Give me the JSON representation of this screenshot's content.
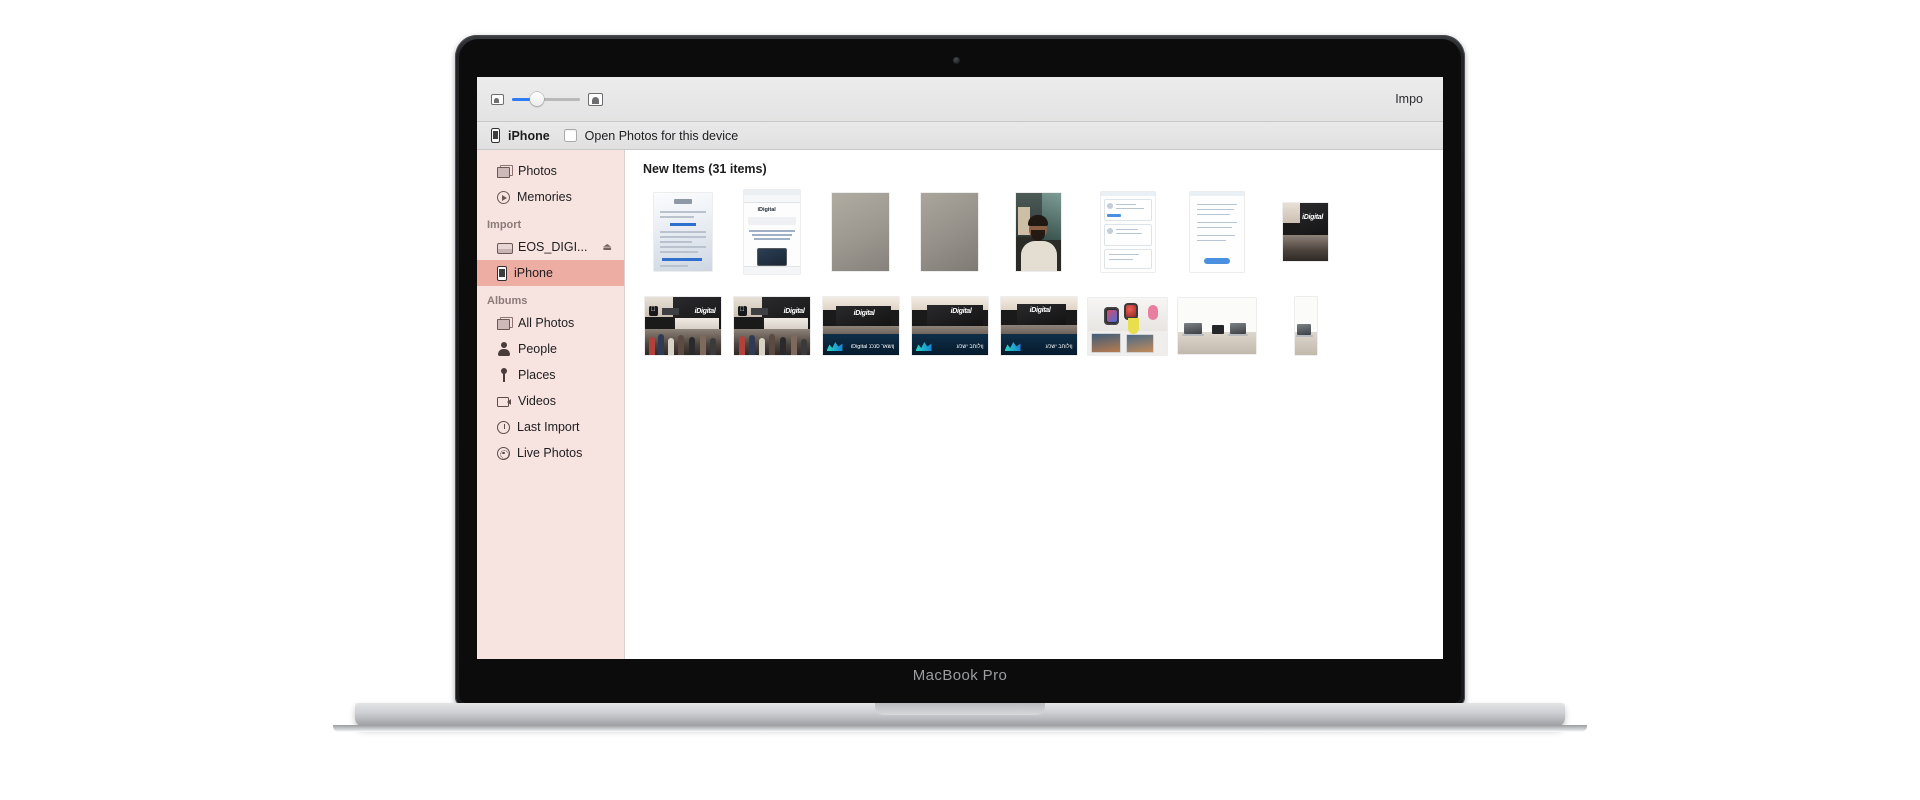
{
  "device": {
    "model_label": "MacBook Pro"
  },
  "app": {
    "toolbar": {
      "zoom_small_icon": "small-photo-icon",
      "zoom_large_icon": "large-photo-icon",
      "zoom_value_percent": 35,
      "import_button_label": "Impo"
    },
    "device_bar": {
      "device_icon": "iphone-icon",
      "device_name": "iPhone",
      "checkbox_checked": false,
      "checkbox_label": "Open Photos for this device"
    },
    "sidebar": {
      "selected": "iPhone",
      "groups": [
        {
          "header": "",
          "items": [
            {
              "label": "Photos",
              "icon": "photos-icon",
              "eject": ""
            },
            {
              "label": "Memories",
              "icon": "memories-icon",
              "eject": ""
            }
          ]
        },
        {
          "header": "Import",
          "items": [
            {
              "label": "EOS_DIGI...",
              "icon": "drive-icon",
              "eject": "⏏"
            },
            {
              "label": "iPhone",
              "icon": "iphone-icon",
              "eject": ""
            }
          ]
        },
        {
          "header": "Albums",
          "items": [
            {
              "label": "All Photos",
              "icon": "photos-icon",
              "eject": ""
            },
            {
              "label": "People",
              "icon": "people-icon",
              "eject": ""
            },
            {
              "label": "Places",
              "icon": "places-icon",
              "eject": ""
            },
            {
              "label": "Videos",
              "icon": "video-icon",
              "eject": ""
            },
            {
              "label": "Last Import",
              "icon": "clock-icon",
              "eject": ""
            },
            {
              "label": "Live Photos",
              "icon": "livephoto-icon",
              "eject": ""
            }
          ]
        }
      ]
    },
    "content": {
      "section_title": "New Items (31 items)",
      "item_count": 31,
      "thumbnails_row1": [
        {
          "kind": "document-scan",
          "caption": "scanned form document"
        },
        {
          "kind": "app-screenshot",
          "caption": "iDigital app order screen"
        },
        {
          "kind": "blank-photo",
          "caption": "blurred neutral photo"
        },
        {
          "kind": "blank-photo",
          "caption": "blurred neutral photo"
        },
        {
          "kind": "portrait",
          "caption": "man with beard portrait"
        },
        {
          "kind": "ui-screenshot",
          "caption": "mobile app screenshot"
        },
        {
          "kind": "ui-screenshot",
          "caption": "mobile text screenshot"
        },
        {
          "kind": "store-photo",
          "caption": "iDigital store front"
        }
      ],
      "thumbnails_row2": [
        {
          "kind": "store-photo",
          "caption": "iDigital storefront with Apple logo"
        },
        {
          "kind": "store-photo",
          "caption": "iDigital storefront with Apple logo"
        },
        {
          "kind": "store-banner",
          "caption": "iDigital store with banner"
        },
        {
          "kind": "store-banner",
          "caption": "iDigital store with banner"
        },
        {
          "kind": "store-banner",
          "caption": "iDigital store with banner"
        },
        {
          "kind": "watch-display",
          "caption": "Apple Watch and iMac display"
        },
        {
          "kind": "table-display",
          "caption": "MacBook and iPad display table"
        },
        {
          "kind": "table-display",
          "caption": "product display table"
        }
      ]
    }
  },
  "colors": {
    "sidebar_bg": "#f7e4e1",
    "sidebar_selected": "#eeada3",
    "accent_blue": "#2e7bf6",
    "toolbar_bg": "#ececed",
    "content_bg": "#ffffff"
  }
}
